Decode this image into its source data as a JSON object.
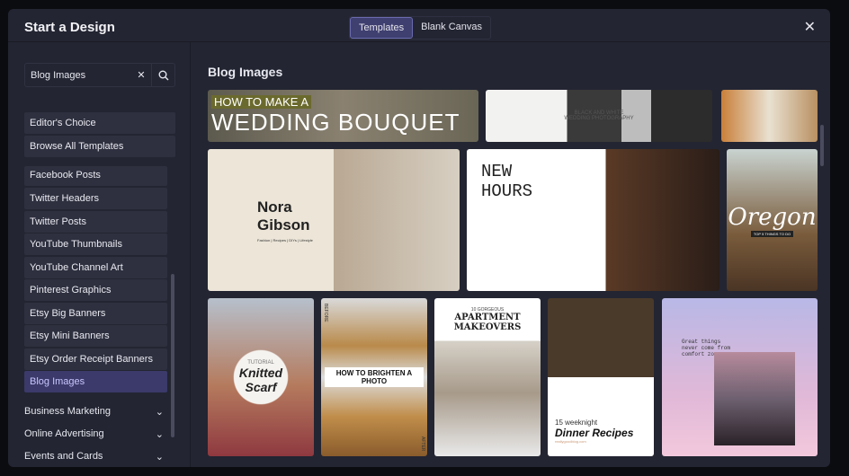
{
  "header": {
    "title": "Start a Design",
    "tabs": [
      {
        "label": "Templates",
        "active": true
      },
      {
        "label": "Blank Canvas",
        "active": false
      }
    ],
    "close_icon": "close-icon"
  },
  "sidebar": {
    "search": {
      "value": "Blog Images",
      "clear_icon": "clear-icon",
      "search_icon": "search-icon"
    },
    "top_items": [
      {
        "label": "Editor's Choice"
      },
      {
        "label": "Browse All Templates"
      }
    ],
    "items": [
      {
        "label": "Facebook Posts"
      },
      {
        "label": "Twitter Headers"
      },
      {
        "label": "Twitter Posts"
      },
      {
        "label": "YouTube Thumbnails"
      },
      {
        "label": "YouTube Channel Art"
      },
      {
        "label": "Pinterest Graphics"
      },
      {
        "label": "Etsy Big Banners"
      },
      {
        "label": "Etsy Mini Banners"
      },
      {
        "label": "Etsy Order Receipt Banners"
      },
      {
        "label": "Blog Images",
        "active": true
      }
    ],
    "categories": [
      {
        "label": "Business Marketing"
      },
      {
        "label": "Online Advertising"
      },
      {
        "label": "Events and Cards"
      }
    ],
    "accent": "#3b3a6a"
  },
  "main": {
    "title": "Blog Images",
    "templates": [
      {
        "line1": "HOW TO MAKE A",
        "line2": "WEDDING BOUQUET"
      },
      {
        "line1": "BLACK AND WHITE",
        "line2": "WEDDING PHOTOGRAPHY"
      },
      {
        "line1": "",
        "line2": ""
      },
      {
        "line1": "Nora",
        "line2": "Gibson",
        "line3": "Fashion | Recipes | DIYs | Lifestyle"
      },
      {
        "line1": "NEW",
        "line2": "HOURS"
      },
      {
        "line1": "Oregon",
        "line2": "TOP 5 THINGS TO DO"
      },
      {
        "line1": "TUTORIAL",
        "line2": "Knitted Scarf"
      },
      {
        "line1": "BEFORE",
        "line2": "HOW TO BRIGHTEN A PHOTO",
        "line3": "AFTER"
      },
      {
        "line1": "10 GORGEOUS",
        "line2": "APARTMENT MAKEOVERS"
      },
      {
        "line1": "15 weeknight",
        "line2": "Dinner Recipes",
        "line3": "reallygoodblog.com"
      },
      {
        "line1": "Great things never come from comfort zones",
        "line2": ""
      }
    ]
  }
}
